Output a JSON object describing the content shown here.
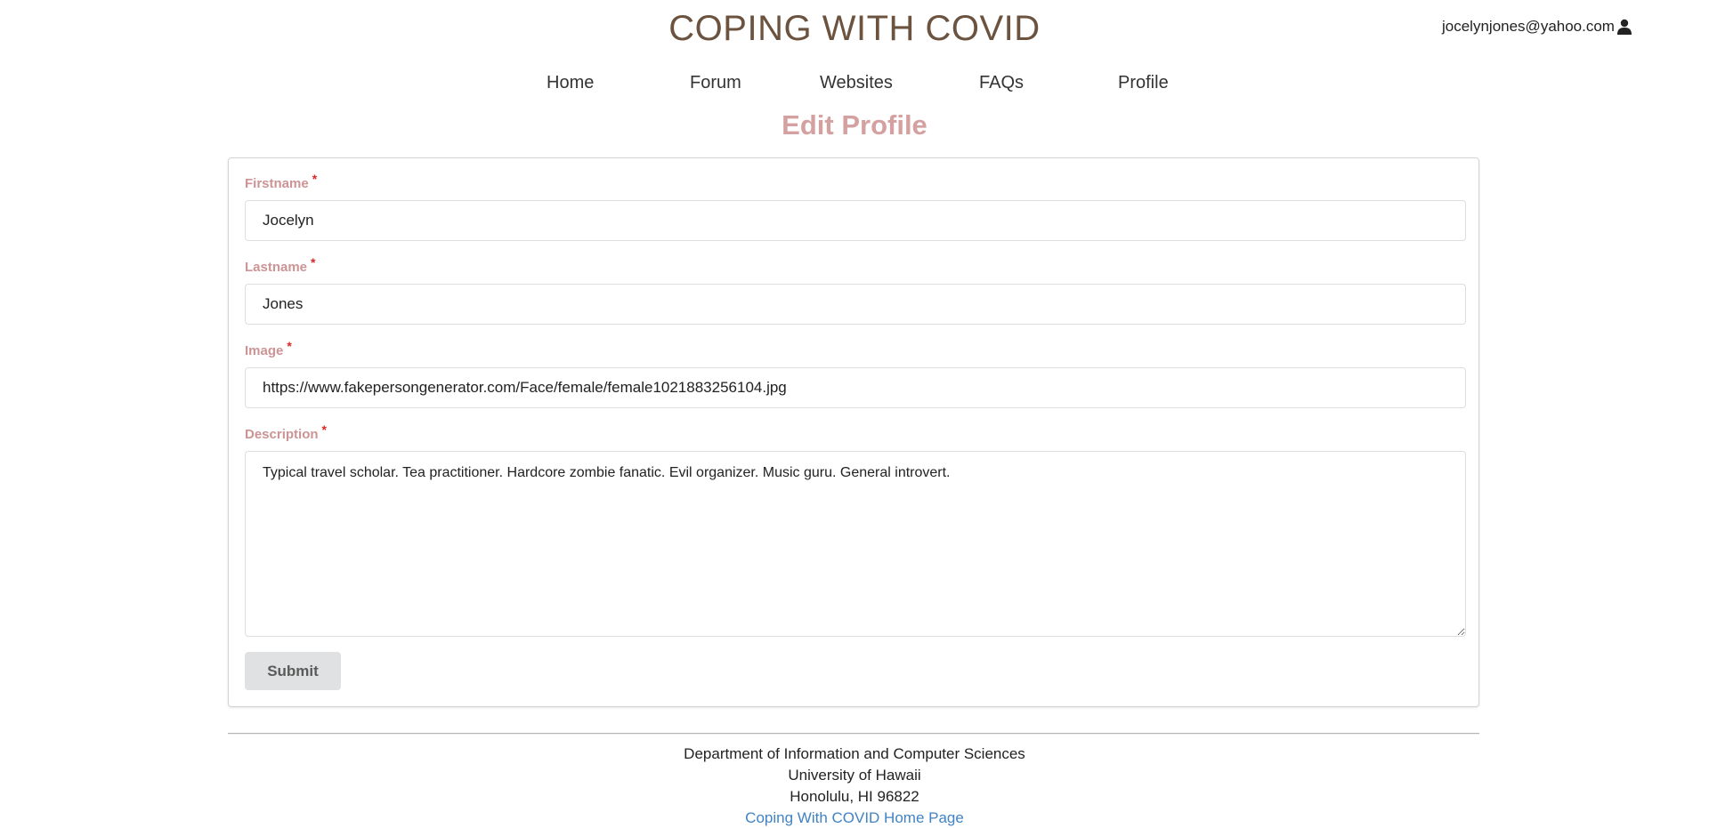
{
  "header": {
    "site_title": "COPING WITH COVID",
    "user_email": "jocelynjones@yahoo.com",
    "user_icon": "user-icon"
  },
  "nav": {
    "items": [
      {
        "label": "Home"
      },
      {
        "label": "Forum"
      },
      {
        "label": "Websites"
      },
      {
        "label": "FAQs"
      },
      {
        "label": "Profile"
      }
    ]
  },
  "page": {
    "heading": "Edit Profile"
  },
  "form": {
    "required_marker": "*",
    "firstname": {
      "label": "Firstname",
      "value": "Jocelyn"
    },
    "lastname": {
      "label": "Lastname",
      "value": "Jones"
    },
    "image": {
      "label": "Image",
      "value": "https://www.fakepersongenerator.com/Face/female/female1021883256104.jpg"
    },
    "description": {
      "label": "Description",
      "value": "Typical travel scholar. Tea practitioner. Hardcore zombie fanatic. Evil organizer. Music guru. General introvert."
    },
    "submit_label": "Submit"
  },
  "footer": {
    "line1": "Department of Information and Computer Sciences",
    "line2": "University of Hawaii",
    "line3": "Honolulu, HI 96822",
    "link_label": "Coping With COVID Home Page"
  },
  "colors": {
    "title": "#6b533f",
    "heading": "#d4a0a0",
    "label": "#cc9494",
    "required": "#db2828",
    "link": "#4183c4",
    "button_bg": "#e0e1e2"
  }
}
